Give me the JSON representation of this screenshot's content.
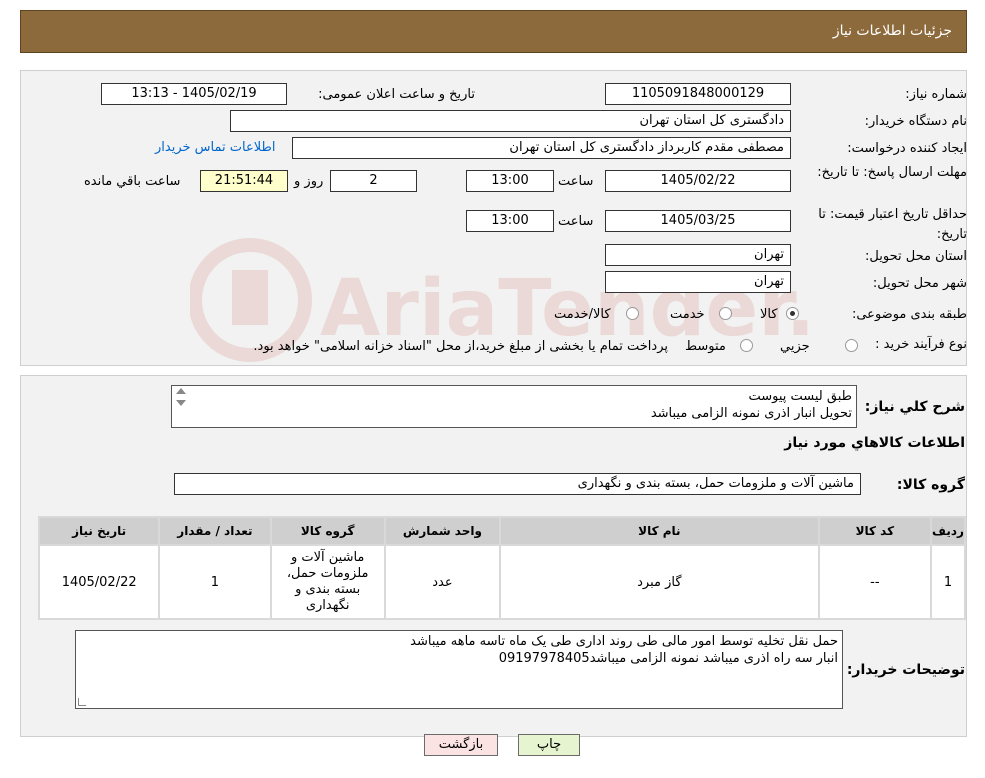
{
  "header": {
    "title": "جزئیات اطلاعات نیاز"
  },
  "form": {
    "need_number_label": "شماره نیاز:",
    "need_number": "1105091848000129",
    "announce_label": "تاریخ و ساعت اعلان عمومی:",
    "announce_value": "1405/02/19 - 13:13",
    "buyer_org_label": "نام دستگاه خریدار:",
    "buyer_org": "دادگستری کل استان تهران",
    "requester_label": "ایجاد کننده درخواست:",
    "requester": "مصطفی مقدم کاربرداز دادگستری کل استان تهران",
    "contact_link": "اطلاعات تماس خریدار",
    "deadline_label": "مهلت ارسال پاسخ: تا تاریخ:",
    "deadline_date": "1405/02/22",
    "time_label": "ساعت",
    "deadline_time": "13:00",
    "days_value": "2",
    "days_label": "روز و",
    "remaining_timer": "21:51:44",
    "remaining_label": "ساعت باقي مانده",
    "price_validity_label": "حداقل تاریخ اعتبار قیمت: تا تاریخ:",
    "price_validity_date": "1405/03/25",
    "price_validity_time": "13:00",
    "province_label": "استان محل تحویل:",
    "province": "تهران",
    "city_label": "شهر محل تحویل:",
    "city": "تهران",
    "category_label": "طبقه بندی موضوعی:",
    "category_options": [
      "کالا",
      "خدمت",
      "کالا/خدمت"
    ],
    "purchase_type_label": "نوع فرآیند خرید :",
    "purchase_options": [
      "جزیي",
      "متوسط"
    ],
    "purchase_note": "پرداخت تمام یا بخشی از مبلغ خرید،از محل \"اسناد خزانه اسلامی\" خواهد بود."
  },
  "summary": {
    "label": "شرح کلي نیاز:",
    "line1": "طبق لیست پیوست",
    "line2": "تحویل انبار اذری نمونه الزامی میباشد"
  },
  "goods": {
    "section_title": "اطلاعات کالاهاي مورد نیاز",
    "group_label": "گروه کالا:",
    "group_value": "ماشین آلات و ملزومات حمل، بسته بندی و نگهداری",
    "columns": [
      "ردیف",
      "کد کالا",
      "نام کالا",
      "واحد شمارش",
      "گروه کالا",
      "تعداد / مقدار",
      "تاریخ نیاز"
    ],
    "rows": [
      {
        "row": "1",
        "code": "--",
        "name": "گاز مبرد",
        "unit": "عدد",
        "group": "ماشین آلات و ملزومات حمل، بسته بندی و نگهداری",
        "qty": "1",
        "date": "1405/02/22"
      }
    ]
  },
  "buyer_notes": {
    "label": "توضیحات خریدار:",
    "line1": "حمل نقل تخلیه توسط امور مالی طی روند اداری طی یک ماه  تاسه ماهه میباشد",
    "line2": "انبار سه راه اذری میباشد  نمونه الزامی میباشد09197978405"
  },
  "buttons": {
    "print": "چاپ",
    "back": "بازگشت"
  },
  "watermark": {
    "text": "AriaTender.neT"
  },
  "colors": {
    "header_bg": "#8c6a3c",
    "link": "#0066cc",
    "timer_bg": "#ffffcc",
    "print_btn": "#e6f5d0",
    "back_btn": "#fbe3e3"
  }
}
